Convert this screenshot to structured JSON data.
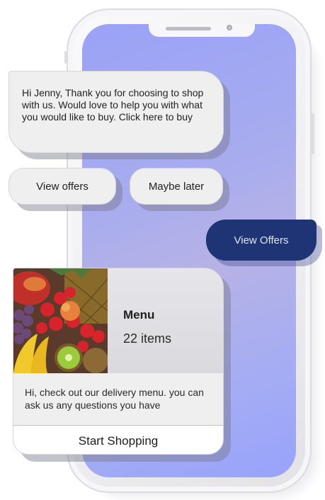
{
  "chat": {
    "greeting": "Hi Jenny, Thank you for choosing to shop with us. Would love to help you with what you would like to buy. Click here to buy",
    "quick_replies": [
      "View offers",
      "Maybe later"
    ],
    "user_message": "View Offers"
  },
  "menu_card": {
    "title": "Menu",
    "item_count": "22 items",
    "description": "Hi, check out our delivery menu. you can ask us any questions you have",
    "action_label": "Start Shopping"
  },
  "colors": {
    "screen": "#9aa2f6",
    "user_bubble": "#1e3474",
    "bot_bubble": "#efefef"
  }
}
